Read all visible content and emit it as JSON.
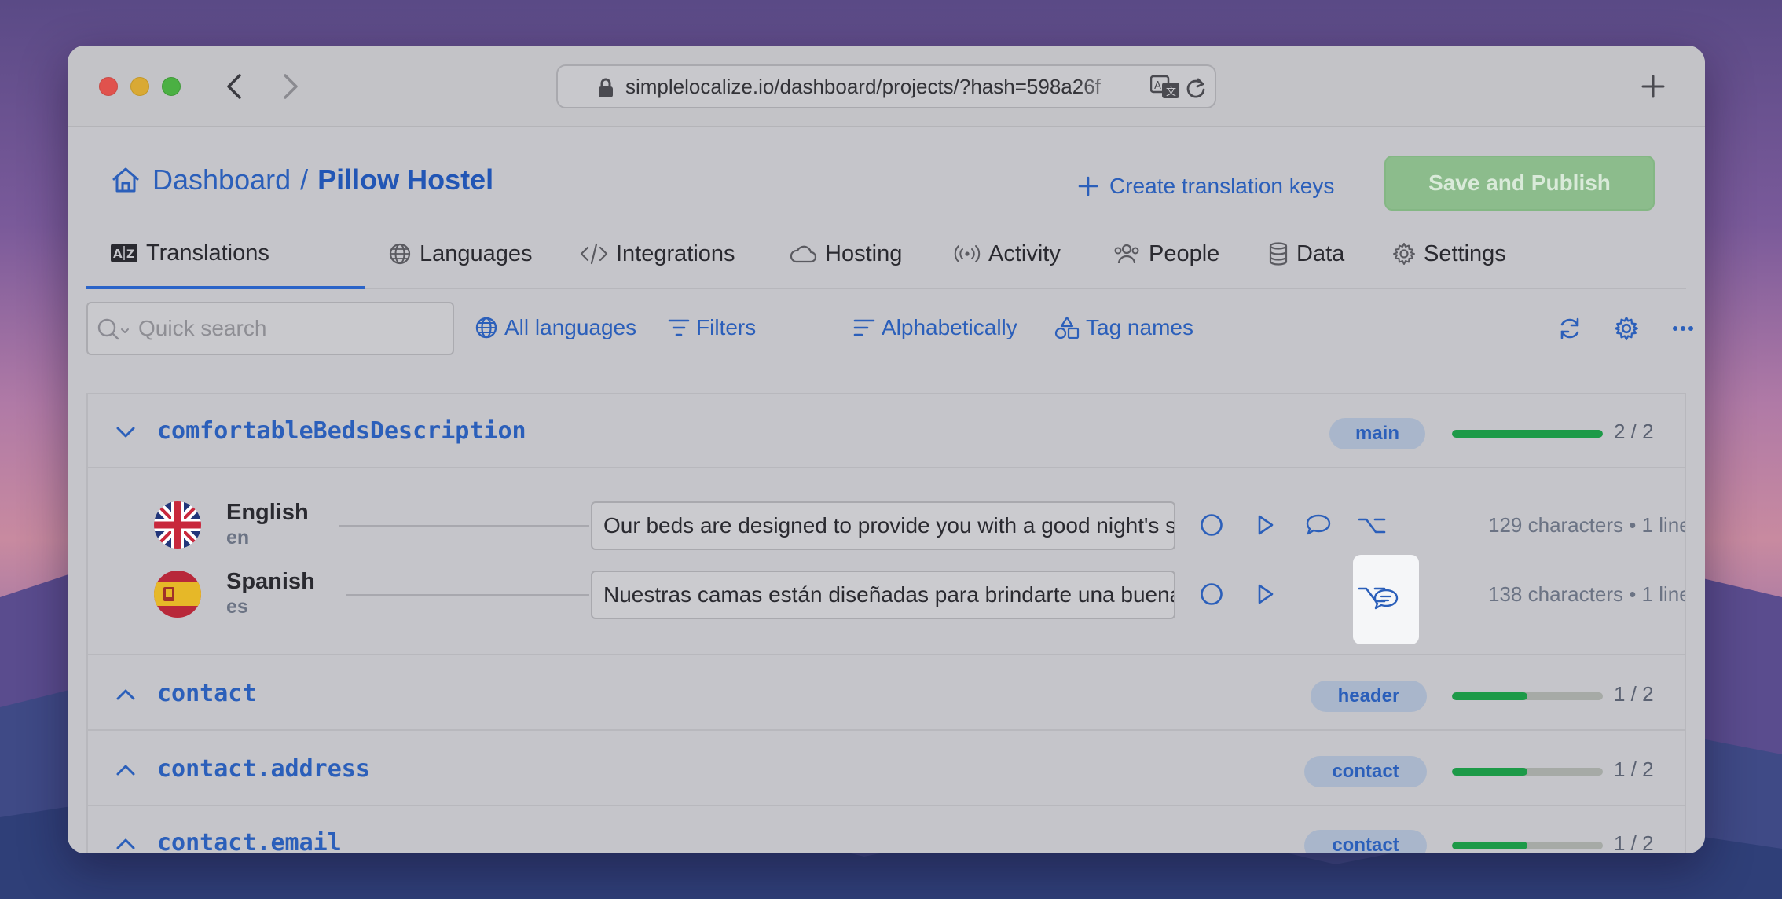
{
  "browser": {
    "url": "simplelocalize.io/dashboard/projects/?hash=598a26f"
  },
  "breadcrumb": {
    "home": "Dashboard",
    "separator": "/",
    "current": "Pillow Hostel"
  },
  "header": {
    "create_keys": "Create translation keys",
    "save_publish": "Save and Publish"
  },
  "tabs": [
    {
      "label": "Translations",
      "icon": "translate-icon"
    },
    {
      "label": "Languages",
      "icon": "globe-icon"
    },
    {
      "label": "Integrations",
      "icon": "code-icon"
    },
    {
      "label": "Hosting",
      "icon": "cloud-icon"
    },
    {
      "label": "Activity",
      "icon": "broadcast-icon"
    },
    {
      "label": "People",
      "icon": "people-icon"
    },
    {
      "label": "Data",
      "icon": "database-icon"
    },
    {
      "label": "Settings",
      "icon": "gear-icon"
    }
  ],
  "toolbar": {
    "search_placeholder": "Quick search",
    "all_languages": "All languages",
    "filters": "Filters",
    "sort": "Alphabetically",
    "tag_names": "Tag names"
  },
  "keys": [
    {
      "name": "comfortableBedsDescription",
      "tag": "main",
      "count": "2 / 2",
      "progress": 1.0,
      "expanded": true
    },
    {
      "name": "contact",
      "tag": "header",
      "count": "1 / 2",
      "progress": 0.5,
      "expanded": false
    },
    {
      "name": "contact.address",
      "tag": "contact",
      "count": "1 / 2",
      "progress": 0.5,
      "expanded": false
    },
    {
      "name": "contact.email",
      "tag": "contact",
      "count": "1 / 2",
      "progress": 0.5,
      "expanded": false
    }
  ],
  "translations": [
    {
      "language": "English",
      "code": "en",
      "text": "Our beds are designed to provide you with a good night's sleep",
      "meta": "129 characters • 1 line"
    },
    {
      "language": "Spanish",
      "code": "es",
      "text": "Nuestras camas están diseñadas para brindarte una buena noche de descanso",
      "meta": "138 characters • 1 line"
    }
  ],
  "colors": {
    "accent": "#2b5fba",
    "progress": "#1d9a48",
    "save_button": "#8cbc8c"
  }
}
